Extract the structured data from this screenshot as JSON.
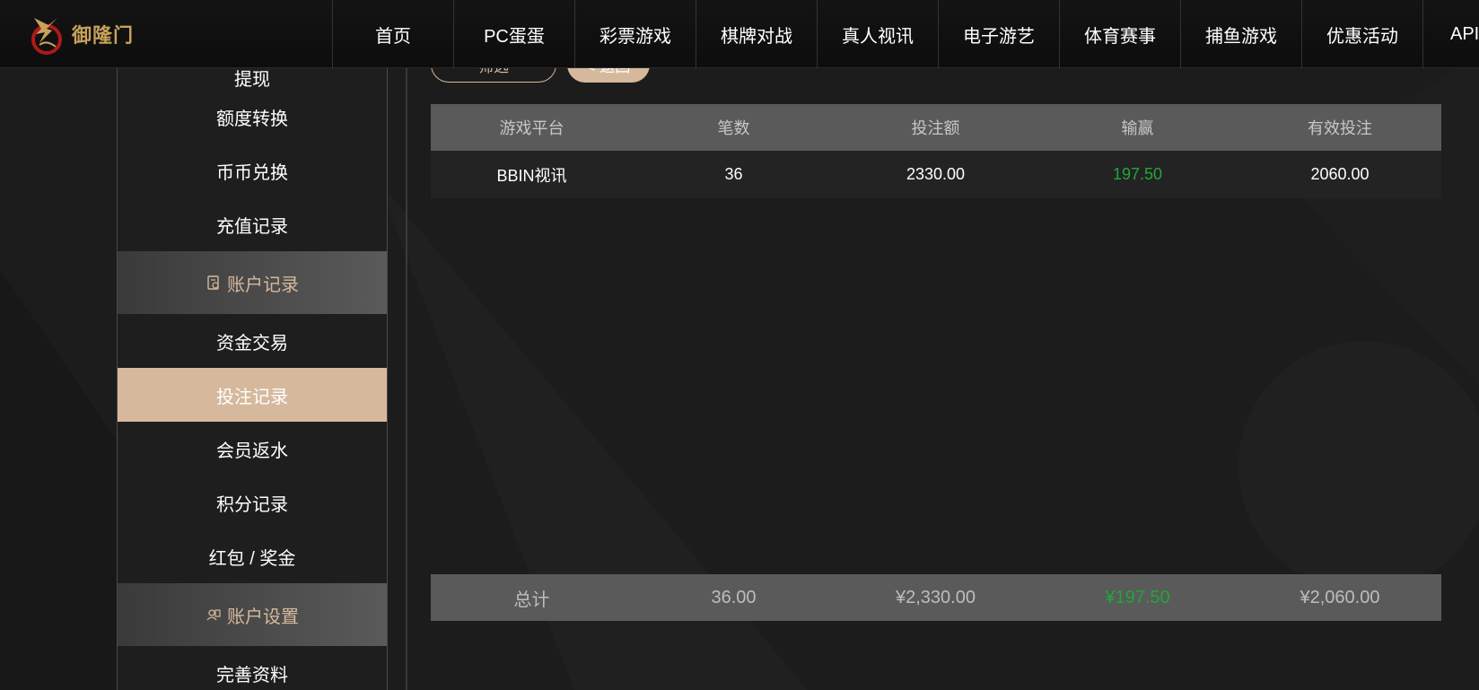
{
  "brand": {
    "name": "御隆门"
  },
  "nav": {
    "items": [
      "首页",
      "PC蛋蛋",
      "彩票游戏",
      "棋牌对战",
      "真人视讯",
      "电子游艺",
      "体育赛事",
      "捕鱼游戏",
      "优惠活动",
      "API"
    ]
  },
  "sidebar": {
    "items_top": [
      "提现",
      "额度转换",
      "币币兑换",
      "充值记录"
    ],
    "section_account_records": "账户记录",
    "items_records": [
      "资金交易",
      "投注记录",
      "会员返水",
      "积分记录",
      "红包 / 奖金"
    ],
    "section_account_settings": "账户设置",
    "items_settings": [
      "完善资料"
    ],
    "active_item": "投注记录"
  },
  "actions": {
    "filter_label": "筛选",
    "back_label": "< 返回"
  },
  "table": {
    "columns": [
      "游戏平台",
      "笔数",
      "投注额",
      "输赢",
      "有效投注"
    ],
    "rows": [
      {
        "platform": "BBIN视讯",
        "count": "36",
        "bet": "2330.00",
        "winloss": "197.50",
        "valid": "2060.00"
      }
    ],
    "total": {
      "label": "总计",
      "count": "36.00",
      "bet": "¥2,330.00",
      "winloss": "¥197.50",
      "valid": "¥2,060.00"
    }
  },
  "colors": {
    "accent": "#d6b99c",
    "positive": "#22a63a",
    "header_bg": "#5a5a5a"
  }
}
